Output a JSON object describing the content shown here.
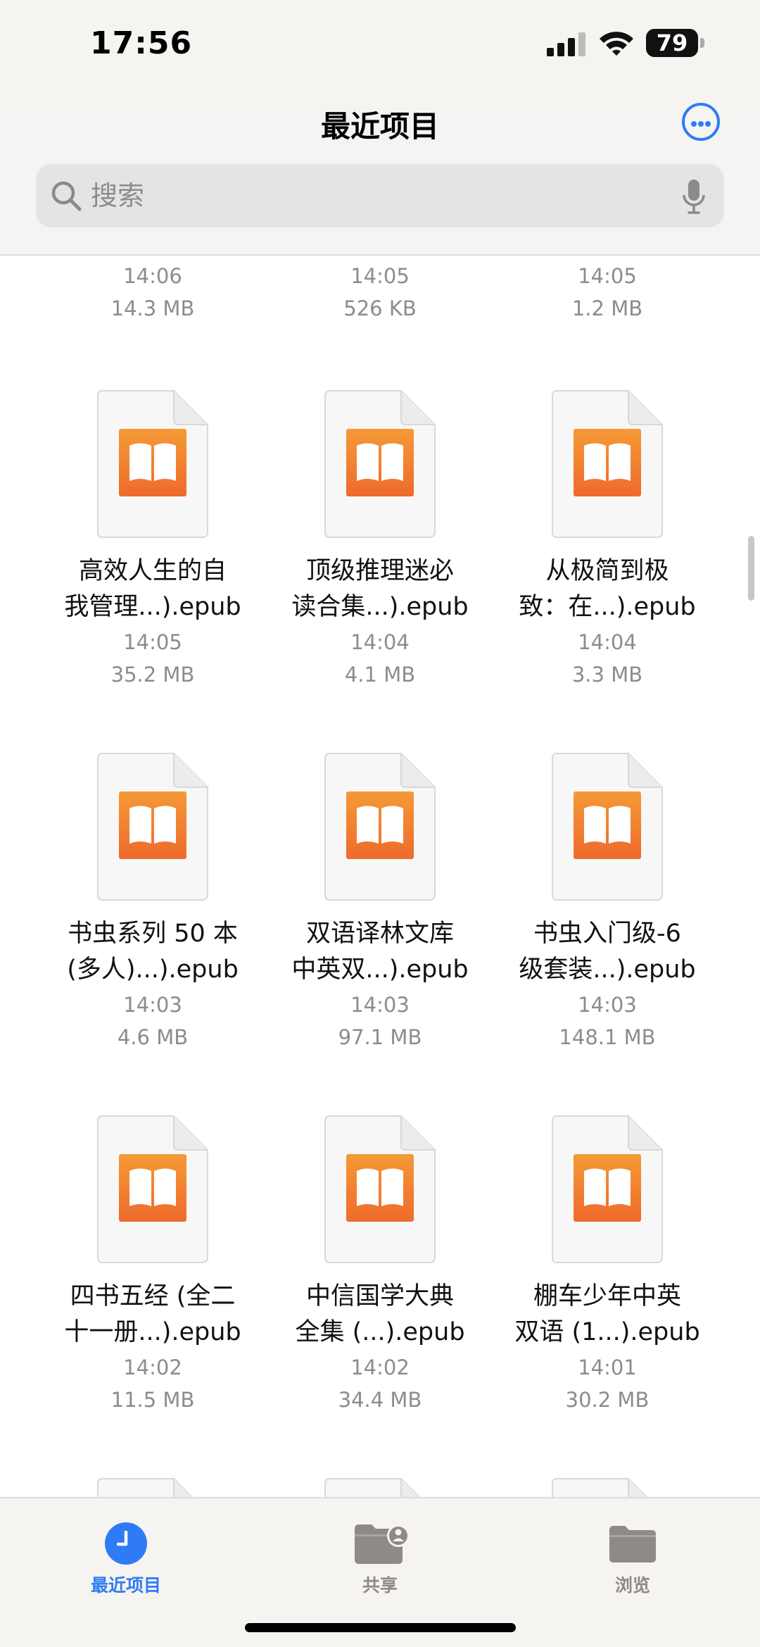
{
  "status_bar": {
    "time": "17:56",
    "battery": "79"
  },
  "header": {
    "title": "最近项目"
  },
  "search": {
    "placeholder": "搜索"
  },
  "partial_row": [
    {
      "time": "14:06",
      "size": "14.3 MB"
    },
    {
      "time": "14:05",
      "size": "526 KB"
    },
    {
      "time": "14:05",
      "size": "1.2 MB"
    }
  ],
  "files": [
    {
      "name_line1": "高效人生的自",
      "name_line2": "我管理...).epub",
      "time": "14:05",
      "size": "35.2 MB"
    },
    {
      "name_line1": "顶级推理迷必",
      "name_line2": "读合集...).epub",
      "time": "14:04",
      "size": "4.1 MB"
    },
    {
      "name_line1": "从极简到极",
      "name_line2": "致：在...).epub",
      "time": "14:04",
      "size": "3.3 MB"
    },
    {
      "name_line1": "书虫系列 50 本",
      "name_line2": "(多人)...).epub",
      "time": "14:03",
      "size": "4.6 MB"
    },
    {
      "name_line1": "双语译林文库",
      "name_line2": "中英双...).epub",
      "time": "14:03",
      "size": "97.1 MB"
    },
    {
      "name_line1": "书虫入门级-6",
      "name_line2": "级套装...).epub",
      "time": "14:03",
      "size": "148.1 MB"
    },
    {
      "name_line1": "四书五经 (全二",
      "name_line2": "十一册...).epub",
      "time": "14:02",
      "size": "11.5 MB"
    },
    {
      "name_line1": "中信国学大典",
      "name_line2": "全集 (...).epub",
      "time": "14:02",
      "size": "34.4 MB"
    },
    {
      "name_line1": "棚车少年中英",
      "name_line2": "双语 (1...).epub",
      "time": "14:01",
      "size": "30.2 MB"
    }
  ],
  "icons": {
    "file": "book-icon",
    "accent": "#2f7bf5",
    "book_orange": "#f28a30",
    "book_orange_dark": "#ee6a2c"
  },
  "tabs": [
    {
      "label": "最近项目",
      "icon": "clock-icon",
      "active": true
    },
    {
      "label": "共享",
      "icon": "shared-folder-icon",
      "active": false
    },
    {
      "label": "浏览",
      "icon": "folder-icon",
      "active": false
    }
  ]
}
